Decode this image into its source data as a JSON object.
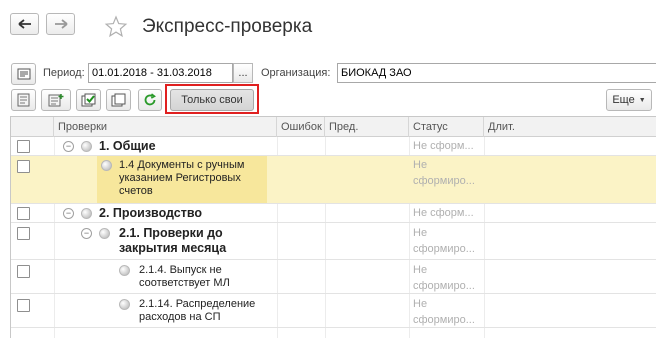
{
  "window": {
    "title": "Экспресс-проверка"
  },
  "nav": {
    "back_icon": "arrow-left-icon",
    "forward_icon": "arrow-right-icon",
    "favorite_icon": "star-icon"
  },
  "filters": {
    "period_label": "Период:",
    "period_value": "01.01.2018 - 31.03.2018",
    "period_button": "...",
    "org_label": "Организация:",
    "org_value": "БИОКАД ЗАО"
  },
  "toolbar": {
    "only_mine_label": "Только свои",
    "more_label": "Еще",
    "highlight_color": "#e02020"
  },
  "table": {
    "columns": [
      "Проверки",
      "Ошибок",
      "Пред.",
      "Статус",
      "Длит."
    ],
    "rows": [
      {
        "lines": [
          "1. Общие"
        ],
        "bold": true,
        "status": [
          "Не сформ..."
        ]
      },
      {
        "lines": [
          "1.4 Документы с ручным",
          "указанием Регистровых",
          "счетов"
        ],
        "bold": false,
        "status": [
          "Не",
          "сформиро..."
        ]
      },
      {
        "lines": [
          "2. Производство"
        ],
        "bold": true,
        "status": [
          "Не сформ..."
        ]
      },
      {
        "lines": [
          "2.1. Проверки до",
          "закрытия месяца"
        ],
        "bold": true,
        "status": [
          "Не",
          "сформиро..."
        ]
      },
      {
        "lines": [
          "2.1.4. Выпуск не",
          "соответствует МЛ"
        ],
        "bold": false,
        "status": [
          "Не",
          "сформиро..."
        ]
      },
      {
        "lines": [
          "2.1.14. Распределение",
          "расходов на СП"
        ],
        "bold": false,
        "status": [
          "Не",
          "сформиро..."
        ]
      }
    ]
  },
  "colors": {
    "selected_row": "#fbf3c6",
    "selected_cell": "#f7e79c"
  }
}
